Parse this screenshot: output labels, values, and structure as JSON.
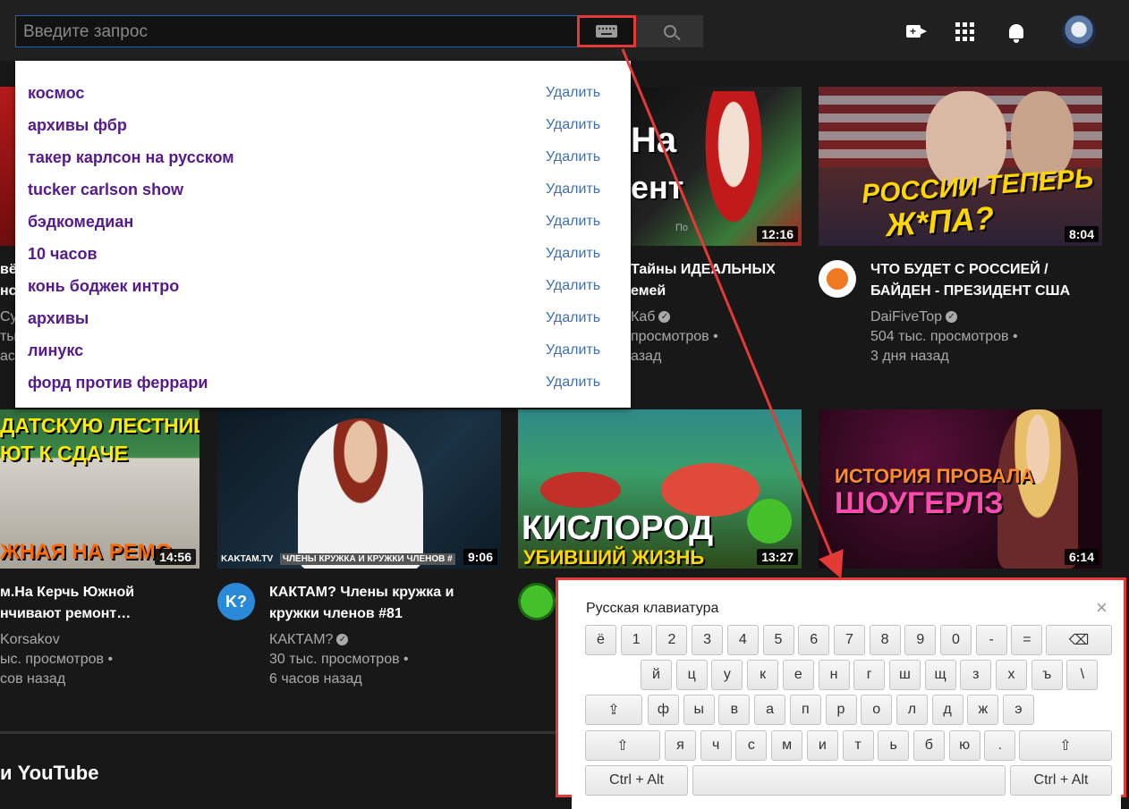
{
  "search": {
    "placeholder": "Введите запрос"
  },
  "header_icons": [
    "create-video-icon",
    "apps-grid-icon",
    "notifications-bell-icon",
    "account-avatar"
  ],
  "suggestions": [
    {
      "text": "космос",
      "delete": "Удалить"
    },
    {
      "text": "архивы фбр",
      "delete": "Удалить"
    },
    {
      "text": "такер карлсон на русском",
      "delete": "Удалить"
    },
    {
      "text": "tucker carlson show",
      "delete": "Удалить"
    },
    {
      "text": "бэдкомедиан",
      "delete": "Удалить"
    },
    {
      "text": "10 часов",
      "delete": "Удалить"
    },
    {
      "text": "конь боджек интро",
      "delete": "Удалить"
    },
    {
      "text": "архивы",
      "delete": "Удалить"
    },
    {
      "text": "линукс",
      "delete": "Удалить"
    },
    {
      "text": "форд против феррари",
      "delete": "Удалить"
    }
  ],
  "videos_row1": {
    "partial_left": {
      "title_line1": "вё",
      "title_line2": "нс",
      "channel": "Су",
      "views": "тыс",
      "age": "ас"
    },
    "middle": {
      "thumb_text1": "На",
      "thumb_text2": "ент",
      "thumb_small": "По",
      "duration": "12:16",
      "title_line1": "Тайны ИДЕАЛЬНЫХ",
      "title_line2": "емей",
      "channel": "Каб",
      "views": "просмотров •",
      "age": "азад"
    },
    "right": {
      "thumb_text1": "РОССИИ ТЕПЕРЬ",
      "thumb_text2": "Ж*ПА?",
      "duration": "8:04",
      "title_line1": "ЧТО БУДЕТ С РОССИЕЙ /",
      "title_line2": "БАЙДЕН - ПРЕЗИДЕНТ США",
      "channel": "DaiFiveTop",
      "views": "504 тыс. просмотров •",
      "age": "3 дня назад"
    }
  },
  "videos_row2": [
    {
      "thumb_text1": "ДАТСКУЮ ЛЕСТНИЦУ",
      "thumb_text2": "ЮТ К СДАЧЕ",
      "thumb_text3": "ЖНАЯ НА РЕМО",
      "duration": "14:56",
      "title_line1": "м.На Керчь Южной",
      "title_line2": "нчивают ремонт…",
      "channel": "Korsakov",
      "views": "ыс. просмотров •",
      "age": "сов назад"
    },
    {
      "thumb_text1": "KAKTAM.TV",
      "thumb_text2": "ЧЛЕНЫ КРУЖКА И КРУЖКИ ЧЛЕНОВ #",
      "duration": "9:06",
      "channel_icon_text": "K?",
      "title_line1": "КАКТАМ? Члены кружка и",
      "title_line2": "кружки членов #81",
      "channel": "КАКТАМ?",
      "views": "30 тыс. просмотров •",
      "age": "6 часов назад"
    },
    {
      "thumb_text1": "КИСЛОРОД",
      "thumb_text2": "УБИВШИЙ ЖИЗНЬ",
      "duration": "13:27",
      "title_line1": "",
      "title_line2": "",
      "channel": ""
    },
    {
      "thumb_text1": "ИСТОРИЯ ПРОВАЛА",
      "thumb_text2": "ШОУГЕРЛЗ",
      "duration": "6:14"
    }
  ],
  "section_title": "и YouTube",
  "keyboard": {
    "title": "Русская клавиатура",
    "close": "×",
    "row1": [
      "ё",
      "1",
      "2",
      "3",
      "4",
      "5",
      "6",
      "7",
      "8",
      "9",
      "0",
      "-",
      "="
    ],
    "row2": [
      "й",
      "ц",
      "у",
      "к",
      "е",
      "н",
      "г",
      "ш",
      "щ",
      "з",
      "х",
      "ъ",
      "\\"
    ],
    "row3": [
      "ф",
      "ы",
      "в",
      "а",
      "п",
      "р",
      "о",
      "л",
      "д",
      "ж",
      "э"
    ],
    "row4": [
      "я",
      "ч",
      "с",
      "м",
      "и",
      "т",
      "ь",
      "б",
      "ю",
      "."
    ],
    "backspace": "⌫",
    "caps": "⇪",
    "shift": "⇧",
    "ctrl_alt": "Ctrl + Alt"
  },
  "colors": {
    "background": "#181818",
    "topbar": "#202020",
    "highlight": "#e53935",
    "suggestion_text": "#551a8b",
    "delete_link": "#3f6fb3"
  }
}
